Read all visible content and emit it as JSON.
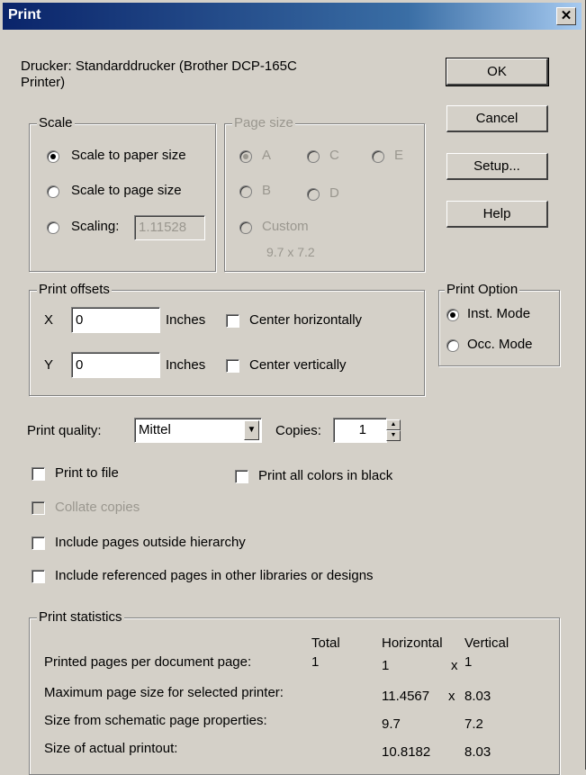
{
  "window": {
    "title": "Print"
  },
  "printer": {
    "line1": "Drucker: Standarddrucker (Brother DCP-165C",
    "line2": "Printer)"
  },
  "buttons": {
    "ok": "OK",
    "cancel": "Cancel",
    "setup": "Setup...",
    "help": "Help"
  },
  "scale": {
    "label": "Scale",
    "to_paper": "Scale to paper size",
    "to_page": "Scale to page size",
    "scaling": "Scaling:",
    "scaling_value": "1.11528",
    "selected": "to_paper"
  },
  "page_size": {
    "label": "Page size",
    "a": "A",
    "b": "B",
    "c": "C",
    "d": "D",
    "e": "E",
    "custom": "Custom",
    "custom_value": "9.7 x 7.2",
    "selected": "A"
  },
  "offsets": {
    "label": "Print offsets",
    "x_label": "X",
    "x_value": "0",
    "y_label": "Y",
    "y_value": "0",
    "units": "Inches",
    "center_h": "Center horizontally",
    "center_v": "Center vertically"
  },
  "print_option": {
    "label": "Print Option",
    "inst": "Inst. Mode",
    "occ": "Occ. Mode",
    "selected": "inst"
  },
  "quality": {
    "label": "Print quality:",
    "value": "Mittel"
  },
  "copies": {
    "label": "Copies:",
    "value": "1"
  },
  "options": {
    "print_to_file": "Print to file",
    "all_black": "Print all colors in black",
    "collate": "Collate copies",
    "outside_hierarchy": "Include pages outside hierarchy",
    "referenced_pages": "Include referenced pages in other libraries or designs"
  },
  "stats": {
    "label": "Print statistics",
    "col_total": "Total",
    "col_horizontal": "Horizontal",
    "col_vertical": "Vertical",
    "rows": [
      {
        "label": "Printed pages per document page:",
        "total": "1",
        "h": "1",
        "x": "x",
        "v": "1"
      },
      {
        "label": "Maximum page size for selected printer:",
        "total": "",
        "h": "11.4567",
        "x": "x",
        "v": "8.03"
      },
      {
        "label": "Size from schematic page properties:",
        "total": "",
        "h": "9.7",
        "x": "",
        "v": "7.2"
      },
      {
        "label": "Size of actual printout:",
        "total": "",
        "h": "10.8182",
        "x": "",
        "v": "8.03"
      }
    ]
  },
  "colors": {
    "title_start": "#0a246a",
    "title_end": "#a6caf0",
    "face": "#d4d0c8"
  }
}
